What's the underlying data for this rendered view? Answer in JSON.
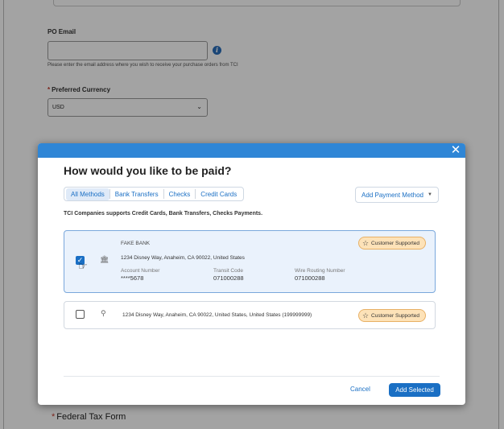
{
  "page": {
    "po_email_label": "PO Email",
    "po_email_value": "",
    "po_email_help": "Please enter the email address where you wish to receive your purchase orders from TCI",
    "currency_required_mark": "*",
    "currency_label": "Preferred Currency",
    "currency_value": "USD",
    "tax_required_mark": "*",
    "tax_form_label": "Federal Tax Form"
  },
  "modal": {
    "title": "How would you like to be paid?",
    "close_icon": "close-icon",
    "tabs": [
      {
        "label": "All Methods",
        "active": true
      },
      {
        "label": "Bank Transfers",
        "active": false
      },
      {
        "label": "Checks",
        "active": false
      },
      {
        "label": "Credit Cards",
        "active": false
      }
    ],
    "add_method_label": "Add Payment Method",
    "supports_text": "TCI Companies supports Credit Cards, Bank Transfers, Checks Payments.",
    "methods": [
      {
        "selected": true,
        "icon": "bank-icon",
        "name": "FAKE BANK",
        "address": "1234 Disney Way, Anaheim, CA 90022, United States",
        "account_label": "Account Number",
        "account_value": "****5678",
        "transit_label": "Transit Code",
        "transit_value": "071000288",
        "routing_label": "Wire Routing Number",
        "routing_value": "071000288",
        "badge": "Customer Supported"
      },
      {
        "selected": false,
        "icon": "location-pin-icon",
        "address": "1234 Disney Way, Anaheim, CA 90022, United States, United States (199999999)",
        "badge": "Customer Supported"
      }
    ],
    "cancel_label": "Cancel",
    "add_selected_label": "Add Selected"
  },
  "colors": {
    "accent": "#1a6fc4",
    "header_bar": "#2f86d6",
    "badge_bg": "#fde2b8",
    "selected_card_bg": "#eaf2fc"
  }
}
